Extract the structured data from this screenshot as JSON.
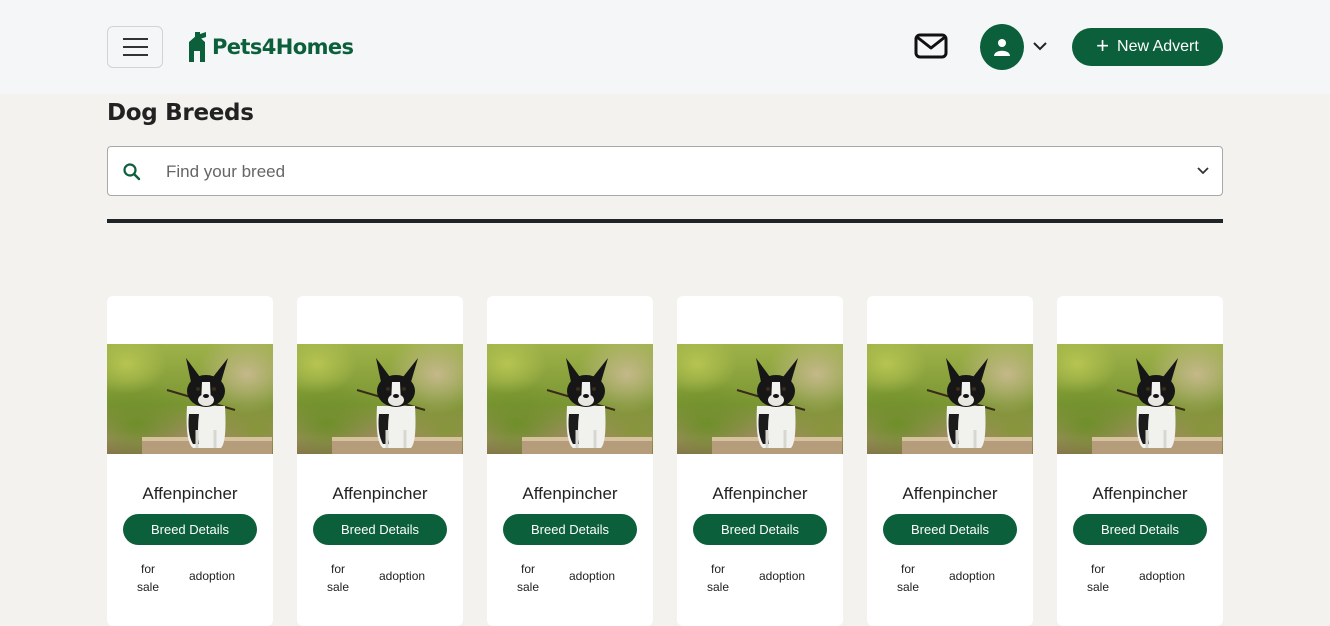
{
  "header": {
    "logo_text": "Pets4Homes",
    "new_advert_label": "New Advert",
    "brand_color": "#0b5f3a"
  },
  "page": {
    "title": "Dog Breeds"
  },
  "search": {
    "placeholder": "Find your breed"
  },
  "cards": [
    {
      "name": "Affenpincher",
      "button": "Breed Details",
      "sale": "for sale",
      "adoption": "adoption"
    },
    {
      "name": "Affenpincher",
      "button": "Breed Details",
      "sale": "for sale",
      "adoption": "adoption"
    },
    {
      "name": "Affenpincher",
      "button": "Breed Details",
      "sale": "for sale",
      "adoption": "adoption"
    },
    {
      "name": "Affenpincher",
      "button": "Breed Details",
      "sale": "for sale",
      "adoption": "adoption"
    },
    {
      "name": "Affenpincher",
      "button": "Breed Details",
      "sale": "for sale",
      "adoption": "adoption"
    },
    {
      "name": "Affenpincher",
      "button": "Breed Details",
      "sale": "for sale",
      "adoption": "adoption"
    }
  ],
  "icons": [
    "menu-icon",
    "logo-icon",
    "mail-icon",
    "user-icon",
    "chevron-down-icon",
    "plus-icon",
    "search-icon"
  ]
}
